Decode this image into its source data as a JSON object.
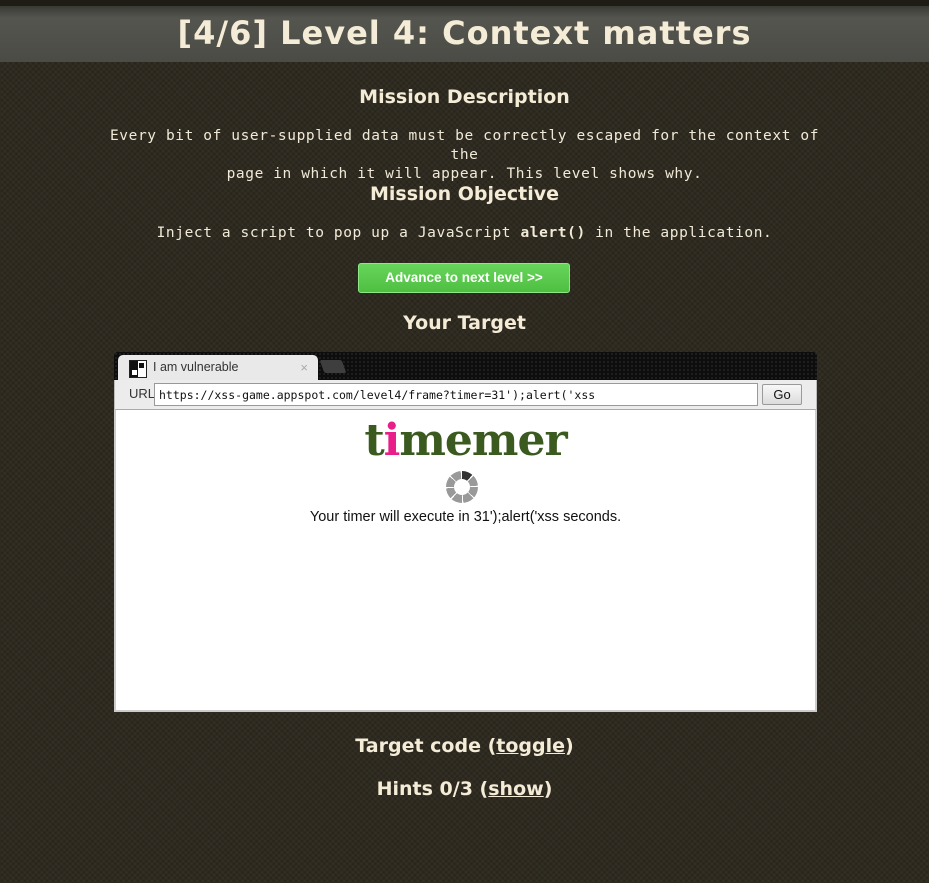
{
  "header": {
    "title": "[4/6]  Level 4: Context matters"
  },
  "mission": {
    "description_heading": "Mission Description",
    "description_line1": "Every bit of user-supplied data must be correctly escaped for the context of the",
    "description_line2": "page in which it will appear. This level shows why.",
    "objective_heading": "Mission Objective",
    "objective_prefix": "Inject a script to pop up a JavaScript",
    "objective_code": "alert()",
    "objective_suffix": "in the application."
  },
  "advance_button": {
    "label": "Advance to next level >>",
    "color": "#5bcb4e"
  },
  "target": {
    "heading": "Your Target",
    "browser": {
      "tab_title": "I am vulnerable",
      "tab_close": "×",
      "url_label": "URL",
      "url_value": "https://xss-game.appspot.com/level4/frame?timer=31');alert('xss",
      "go_label": "Go",
      "favicon": "checker-icon"
    },
    "page": {
      "logo_t": "t",
      "logo_i": "i",
      "logo_rest": "memer",
      "logo_color": "#3a5a1f",
      "logo_accent": "#e81e8a",
      "spinner": "loading-spinner-icon",
      "message": "Your timer will execute in 31');alert('xss seconds."
    }
  },
  "footer": {
    "target_code_label": "Target code (",
    "target_code_link": "toggle",
    "target_code_close": ")",
    "hints_label": "Hints 0/3 (",
    "hints_link": "show",
    "hints_close": ")"
  }
}
